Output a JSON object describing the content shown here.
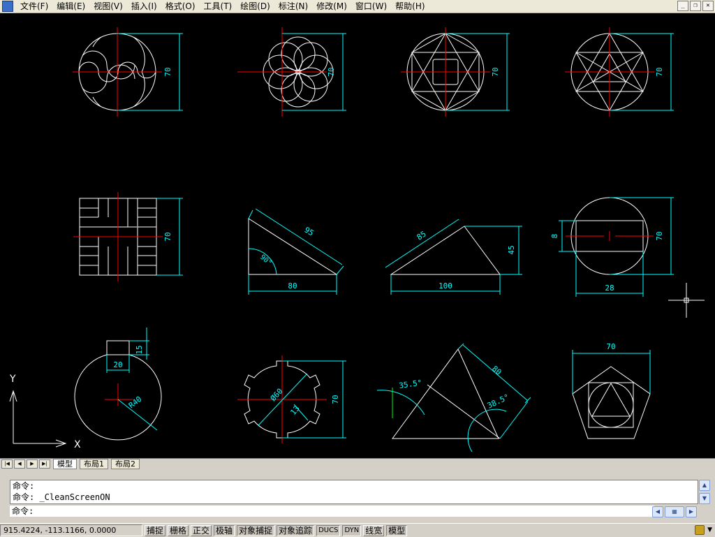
{
  "menubar": {
    "items": [
      "文件(F)",
      "编辑(E)",
      "视图(V)",
      "插入(I)",
      "格式(O)",
      "工具(T)",
      "绘图(D)",
      "标注(N)",
      "修改(M)",
      "窗口(W)",
      "帮助(H)"
    ]
  },
  "window_controls": {
    "minimize": "_",
    "restore": "❐",
    "close": "✕"
  },
  "drawing": {
    "colors": {
      "background": "#000000",
      "geometry": "#ffffff",
      "center_lines": "#ff0000",
      "dimensions": "#00ffff",
      "angle_marks": "#00ff00",
      "crosshair": "#ffffff"
    },
    "dimensions": {
      "d1": "70",
      "d2": "70",
      "d3": "70",
      "d4": "70",
      "d5": "70",
      "d6": "95",
      "d7": "90°",
      "d8": "80",
      "d9": "85",
      "d10": "100",
      "d11": "45",
      "d12": "8",
      "d13": "70",
      "d14": "28",
      "d15": "15",
      "d16": "20",
      "d17": "R40",
      "d18": "Ø60",
      "d19": "13",
      "d20": "70",
      "d21": "35.5°",
      "d22": "80",
      "d23": "38.5°",
      "d24": "70"
    },
    "ucs": {
      "x_label": "X",
      "y_label": "Y"
    }
  },
  "layout_tabs": {
    "nav": [
      "|◀",
      "◀",
      "▶",
      "▶|"
    ],
    "tabs": [
      "模型",
      "布局1",
      "布局2"
    ],
    "active": "模型"
  },
  "command_window": {
    "history": [
      "命令:",
      "命令: _CleanScreenON"
    ],
    "prompt": "命令:",
    "scroll_up": "▲",
    "scroll_down": "▼"
  },
  "statusbar": {
    "coordinates": "915.4224,  -113.1166,  0.0000",
    "toggles": [
      "捕捉",
      "栅格",
      "正交",
      "极轴",
      "对象捕捉",
      "对象追踪",
      "DUCS",
      "DYN",
      "线宽",
      "模型"
    ],
    "active_toggles": [
      "极轴",
      "对象捕捉",
      "对象追踪",
      "DUCS",
      "DYN",
      "模型"
    ]
  }
}
